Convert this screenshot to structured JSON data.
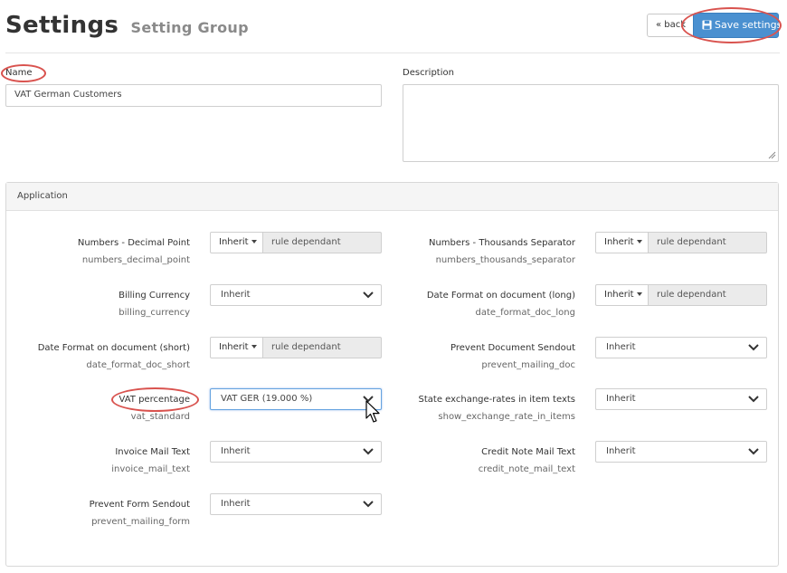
{
  "header": {
    "title": "Settings",
    "subtitle": "Setting Group",
    "back_label": "« back",
    "save_label": "Save settings"
  },
  "form": {
    "name_label": "Name",
    "name_value": "VAT German Customers",
    "description_label": "Description",
    "description_value": ""
  },
  "panel": {
    "title": "Application"
  },
  "settings": {
    "numbers_decimal_point": {
      "label": "Numbers - Decimal Point",
      "key": "numbers_decimal_point",
      "inherit": "Inherit",
      "value": "rule dependant"
    },
    "numbers_thousands_separator": {
      "label": "Numbers - Thousands Separator",
      "key": "numbers_thousands_separator",
      "inherit": "Inherit",
      "value": "rule dependant"
    },
    "billing_currency": {
      "label": "Billing Currency",
      "key": "billing_currency",
      "value": "Inherit"
    },
    "date_format_doc_long": {
      "label": "Date Format on document (long)",
      "key": "date_format_doc_long",
      "inherit": "Inherit",
      "value": "rule dependant"
    },
    "date_format_doc_short": {
      "label": "Date Format on document (short)",
      "key": "date_format_doc_short",
      "inherit": "Inherit",
      "value": "rule dependant"
    },
    "prevent_mailing_doc": {
      "label": "Prevent Document Sendout",
      "key": "prevent_mailing_doc",
      "value": "Inherit"
    },
    "vat_standard": {
      "label": "VAT percentage",
      "key": "vat_standard",
      "value": "VAT GER (19.000 %)"
    },
    "show_exchange_rate_in_items": {
      "label": "State exchange-rates in item texts",
      "key": "show_exchange_rate_in_items",
      "value": "Inherit"
    },
    "invoice_mail_text": {
      "label": "Invoice Mail Text",
      "key": "invoice_mail_text",
      "value": "Inherit"
    },
    "credit_note_mail_text": {
      "label": "Credit Note Mail Text",
      "key": "credit_note_mail_text",
      "value": "Inherit"
    },
    "prevent_mailing_form": {
      "label": "Prevent Form Sendout",
      "key": "prevent_mailing_form",
      "value": "Inherit"
    }
  },
  "colors": {
    "primary_button": "#4a90d0",
    "highlight_ring": "#d9534f",
    "readonly_field": "#ebebeb"
  },
  "icons": {
    "save": "floppy-disk-icon",
    "dropdown": "chevron-down-icon",
    "cursor": "mouse-pointer-icon"
  }
}
